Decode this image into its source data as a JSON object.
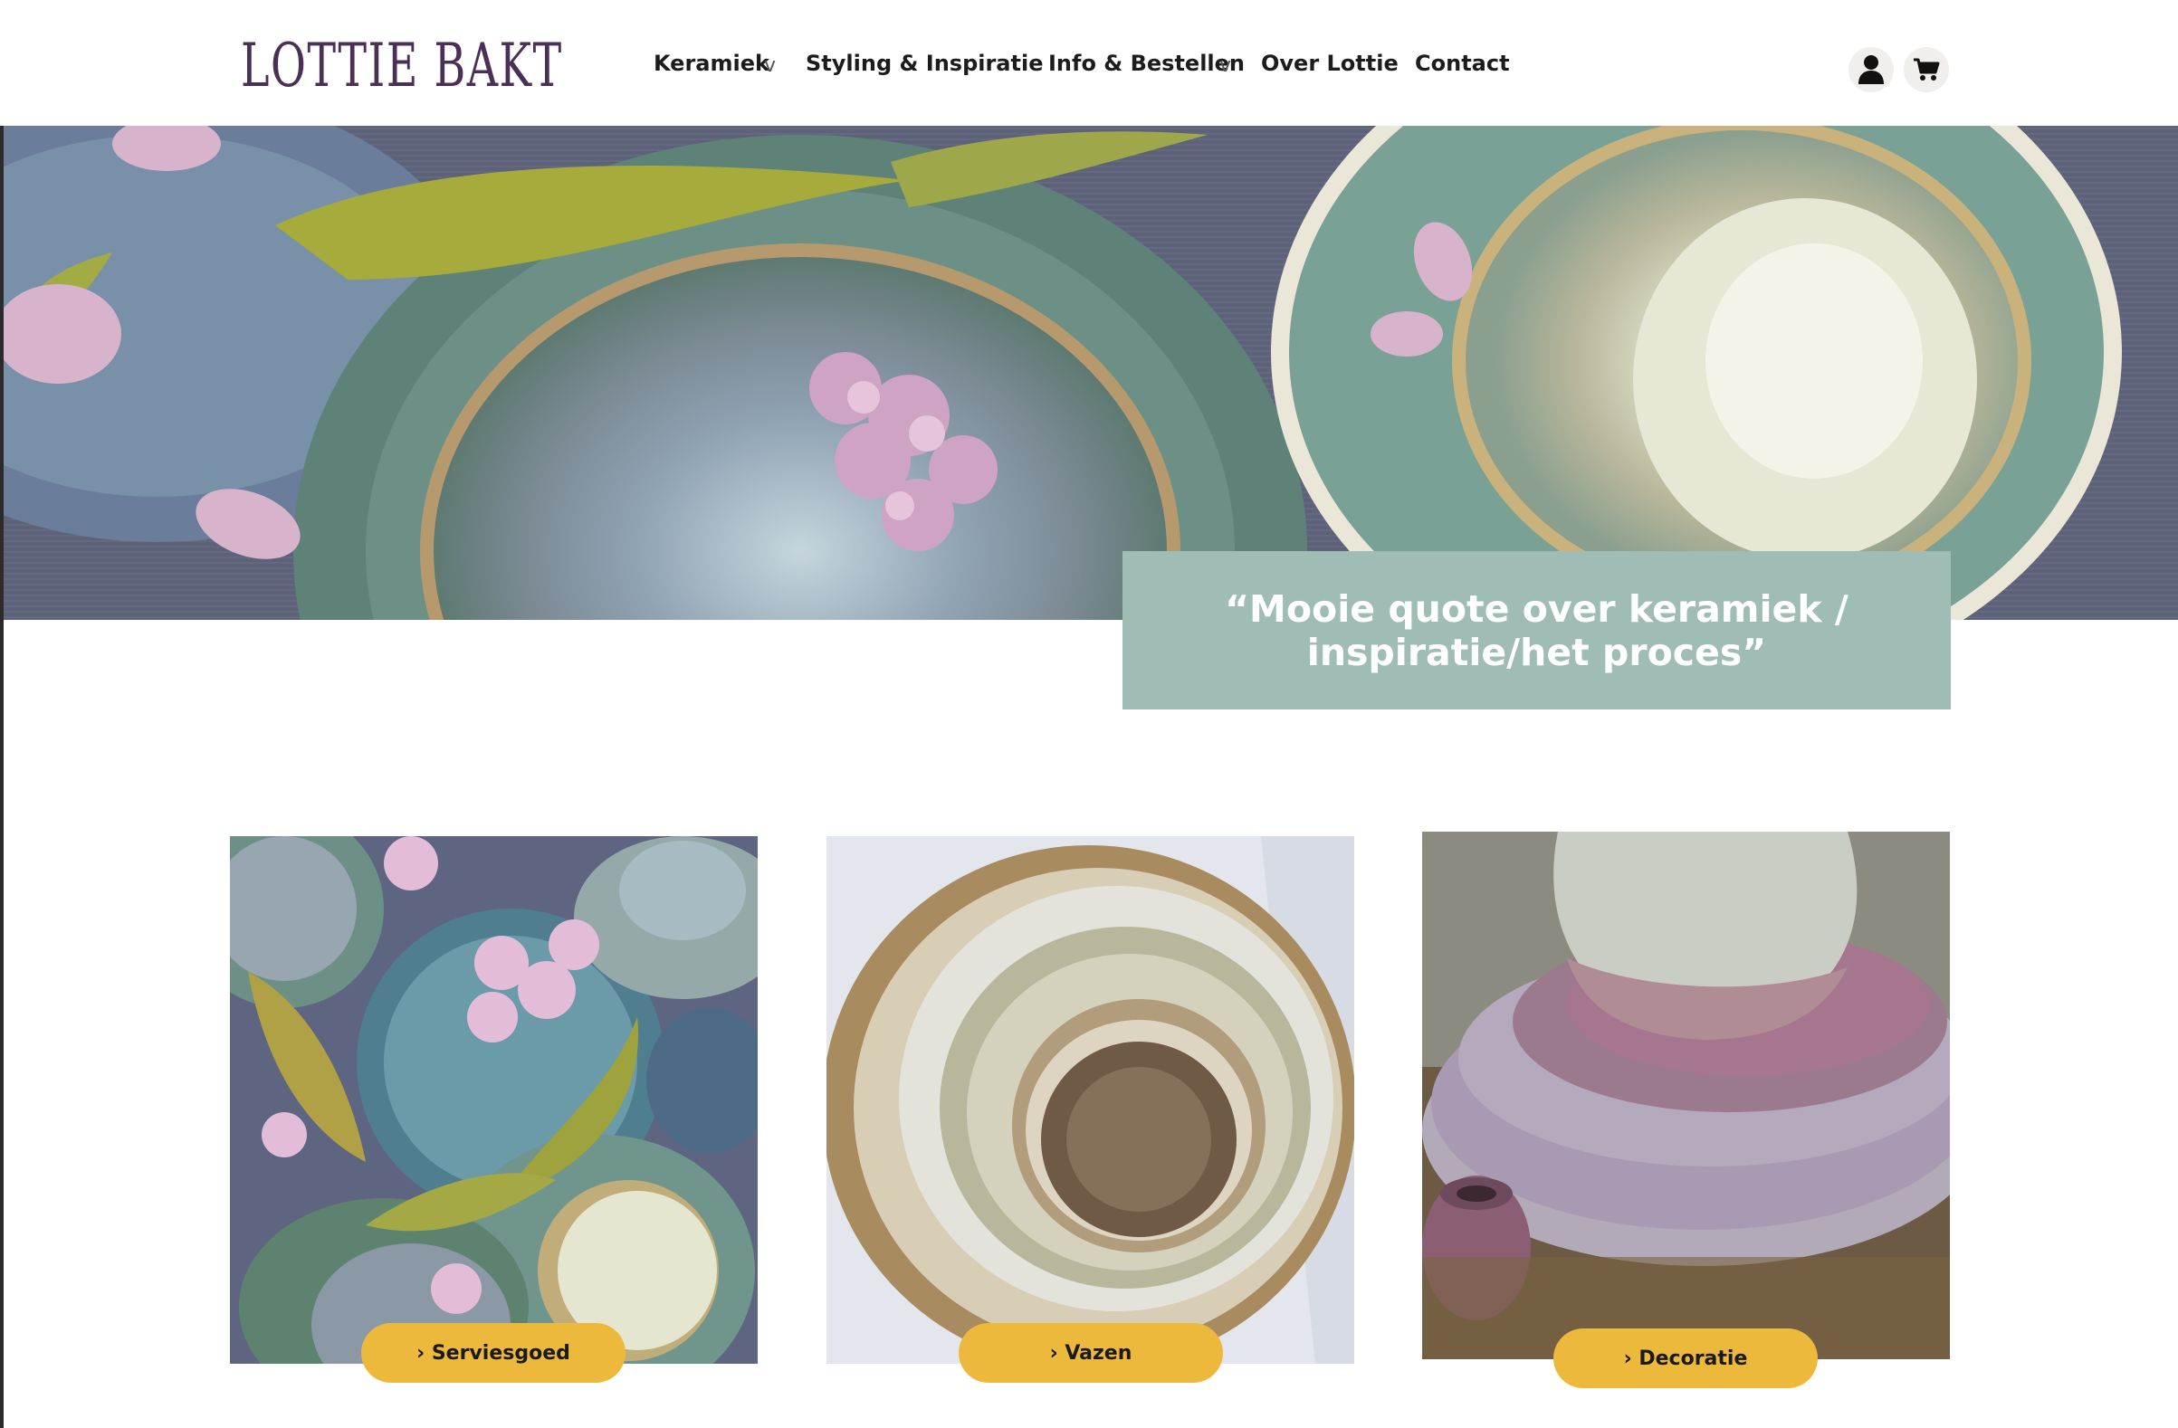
{
  "header": {
    "logo_text": "LOTTIE BAKT",
    "nav": [
      {
        "label": "Keramiek",
        "has_dropdown": true
      },
      {
        "label": "Styling & Inspiratie",
        "has_dropdown": false
      },
      {
        "label": "Info & Bestellen",
        "has_dropdown": true
      },
      {
        "label": "Over Lottie",
        "has_dropdown": false
      },
      {
        "label": "Contact",
        "has_dropdown": false
      }
    ],
    "dropdown_glyph": "v",
    "icons": [
      "user-icon",
      "cart-icon"
    ]
  },
  "hero": {
    "quote": "“Mooie quote over keramiek / inspiratie/het proces”",
    "quote_bg_color": "#a0bdb5"
  },
  "categories": [
    {
      "label": "› Serviesgoed"
    },
    {
      "label": "› Vazen"
    },
    {
      "label": "› Decoratie"
    }
  ],
  "colors": {
    "logo": "#4a2f56",
    "button": "#edb93d",
    "quote_box": "#a0bdb5"
  }
}
